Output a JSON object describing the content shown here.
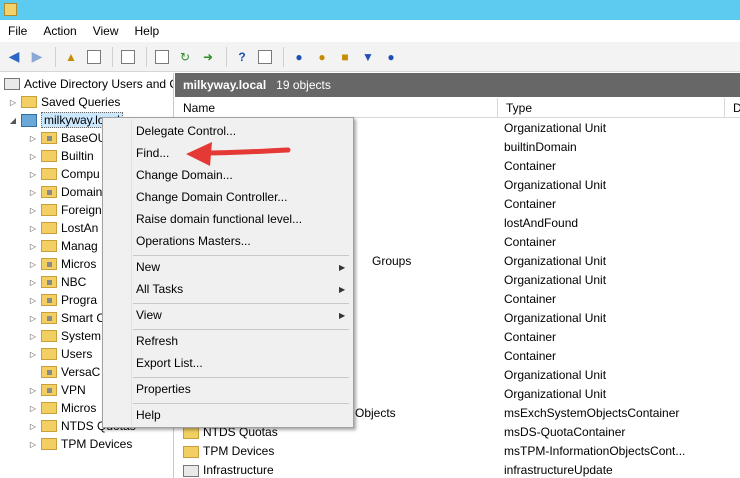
{
  "menubar": {
    "items": [
      "File",
      "Action",
      "View",
      "Help"
    ]
  },
  "toolbar": {
    "icons": [
      "back-arrow-icon",
      "forward-arrow-icon",
      "up-folder-icon",
      "show-tree-icon",
      "clipboard-icon",
      "properties-icon",
      "refresh-icon",
      "export-icon",
      "help-icon",
      "console-icon",
      "users-icon",
      "groups-icon",
      "folder-add-icon",
      "filter-icon",
      "delegate-icon"
    ]
  },
  "tree": {
    "root_label": "Active Directory Users and C",
    "saved_queries": "Saved Queries",
    "domain": "milkyway.local",
    "children": [
      "BaseOU",
      "Builtin",
      "Compu",
      "Domain",
      "Foreign",
      "LostAn",
      "Manag",
      "Micros",
      "NBC",
      "Progra",
      "Smart C",
      "System",
      "Users",
      "VersaC",
      "VPN",
      "Micros",
      "NTDS Quotas",
      "TPM Devices"
    ]
  },
  "right": {
    "header_domain": "milkyway.local",
    "header_count": "19 objects",
    "columns": [
      "Name",
      "Type",
      "Depart"
    ],
    "rows": [
      {
        "name": "",
        "type": "Organizational Unit"
      },
      {
        "name": "",
        "type": "builtinDomain"
      },
      {
        "name": "",
        "type": "Container"
      },
      {
        "name": "",
        "type": "Organizational Unit"
      },
      {
        "name": "",
        "type": "Container"
      },
      {
        "name": "",
        "type": "lostAndFound"
      },
      {
        "name": "",
        "type": "Container"
      },
      {
        "name": "Groups",
        "type": "Organizational Unit"
      },
      {
        "name": "",
        "type": "Organizational Unit"
      },
      {
        "name": "",
        "type": "Container"
      },
      {
        "name": "",
        "type": "Organizational Unit"
      },
      {
        "name": "",
        "type": "Container"
      },
      {
        "name": "",
        "type": "Container"
      },
      {
        "name": "",
        "type": "Organizational Unit"
      },
      {
        "name": "",
        "type": "Organizational Unit"
      },
      {
        "name": "Objects",
        "type": "msExchSystemObjectsContainer"
      },
      {
        "name": "NTDS Quotas",
        "type": "msDS-QuotaContainer"
      },
      {
        "name": "TPM Devices",
        "type": "msTPM-InformationObjectsCont..."
      },
      {
        "name": "Infrastructure",
        "type": "infrastructureUpdate"
      }
    ]
  },
  "context_menu": {
    "delegate": "Delegate Control...",
    "find": "Find...",
    "change_domain": "Change Domain...",
    "change_dc": "Change Domain Controller...",
    "raise_level": "Raise domain functional level...",
    "ops_masters": "Operations Masters...",
    "new": "New",
    "all_tasks": "All Tasks",
    "view": "View",
    "refresh": "Refresh",
    "export_list": "Export List...",
    "properties": "Properties",
    "help": "Help"
  },
  "colors": {
    "titlebar": "#5ccbf0",
    "header": "#676767",
    "annotation_arrow": "#e53935"
  }
}
